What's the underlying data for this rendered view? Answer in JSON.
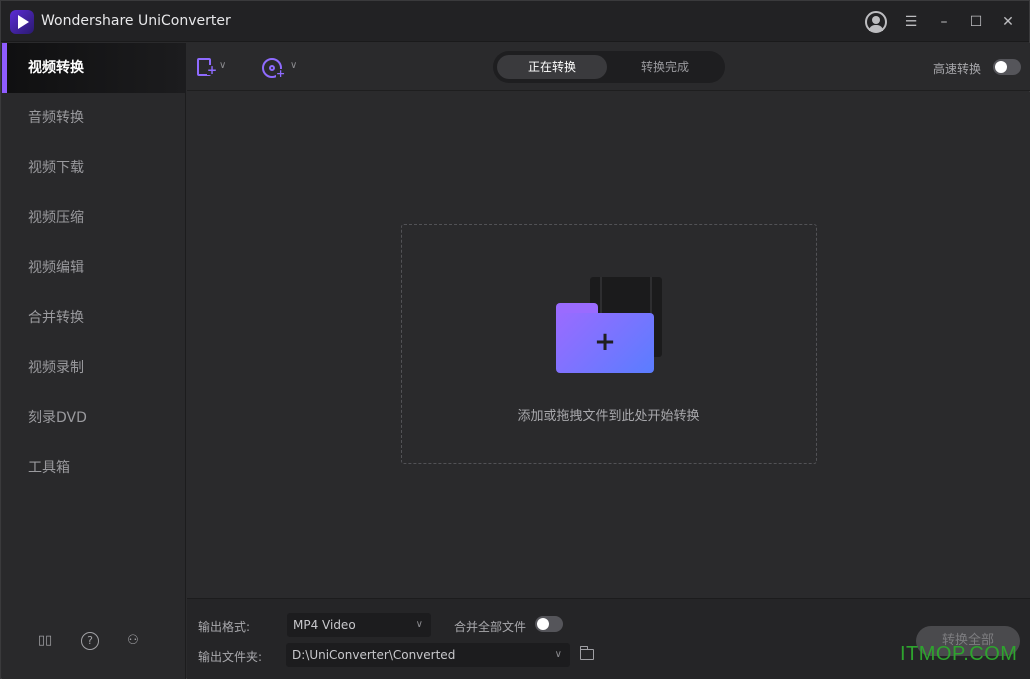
{
  "titlebar": {
    "app_title": "Wondershare UniConverter",
    "buttons": [
      "account-icon",
      "menu-icon",
      "minimize-icon",
      "maximize-icon",
      "close-icon"
    ]
  },
  "sidebar": {
    "items": [
      {
        "label": "视频转换",
        "active": true
      },
      {
        "label": "音频转换"
      },
      {
        "label": "视频下载"
      },
      {
        "label": "视频压缩"
      },
      {
        "label": "视频编辑"
      },
      {
        "label": "合并转换"
      },
      {
        "label": "视频录制"
      },
      {
        "label": "刻录DVD"
      },
      {
        "label": "工具箱"
      }
    ],
    "bottom_icons": [
      "book-icon",
      "help-icon",
      "users-icon"
    ]
  },
  "toolbar": {
    "tabs": [
      {
        "label": "正在转换",
        "active": true
      },
      {
        "label": "转换完成"
      }
    ],
    "high_speed_label": "高速转换",
    "high_speed_on": false
  },
  "main": {
    "drop_hint": "添加或拖拽文件到此处开始转换"
  },
  "bottom": {
    "format_label": "输出格式:",
    "format_value": "MP4 Video",
    "merge_label": "合并全部文件",
    "merge_on": false,
    "folder_label": "输出文件夹:",
    "folder_value": "D:\\UniConverter\\Converted",
    "convert_all_label": "转换全部"
  },
  "watermark": "ITMOP.COM",
  "colors": {
    "accent": "#8f6bff",
    "background": "#2a2a2c",
    "sidebar_active": "#101011"
  }
}
